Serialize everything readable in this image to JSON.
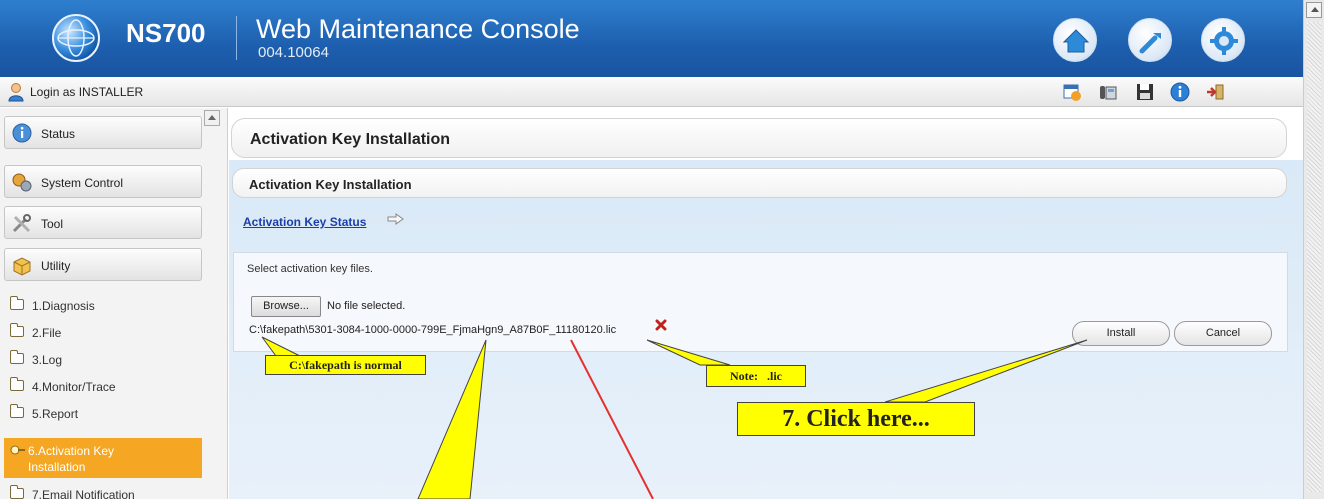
{
  "header": {
    "model": "NS700",
    "title": "Web Maintenance Console",
    "version": "004.10064",
    "buttons": [
      "home-icon",
      "wrench-icon",
      "gear-icon"
    ]
  },
  "login_bar": {
    "text": "Login as INSTALLER",
    "tools": [
      "calendar-icon",
      "phone-icon",
      "save-icon",
      "info-icon",
      "logout-icon"
    ]
  },
  "sidebar": {
    "categories": [
      {
        "label": "Status",
        "icon": "info-icon"
      },
      {
        "label": "System Control",
        "icon": "gears-icon"
      },
      {
        "label": "Tool",
        "icon": "tools-icon"
      },
      {
        "label": "Utility",
        "icon": "box-icon"
      }
    ],
    "items": [
      {
        "label": "1.Diagnosis"
      },
      {
        "label": "2.File"
      },
      {
        "label": "3.Log"
      },
      {
        "label": "4.Monitor/Trace"
      },
      {
        "label": "5.Report"
      },
      {
        "label_line1": "6.Activation Key",
        "label_line2": "Installation",
        "active": true
      },
      {
        "label": "7.Email Notification"
      }
    ]
  },
  "main": {
    "page_title": "Activation Key Installation",
    "section_title": "Activation Key Installation",
    "status_link": "Activation Key Status",
    "instruction": "Select activation key files.",
    "browse_label": "Browse...",
    "file_status": "No file selected.",
    "file_path": "C:\\fakepath\\5301-3084-1000-0000-799E_FjmaHgn9_A87B0F_11180120.lic",
    "install_label": "Install",
    "cancel_label": "Cancel"
  },
  "annotations": {
    "fakepath_note": "C:\\fakepath is normal",
    "ext_note": "Note:   .lic",
    "click_note": "7. Click here..."
  },
  "colors": {
    "header_blue": "#1d5fae",
    "active_orange": "#f5a623",
    "callout_yellow": "#ffff00",
    "link_blue": "#1a3fa8"
  }
}
